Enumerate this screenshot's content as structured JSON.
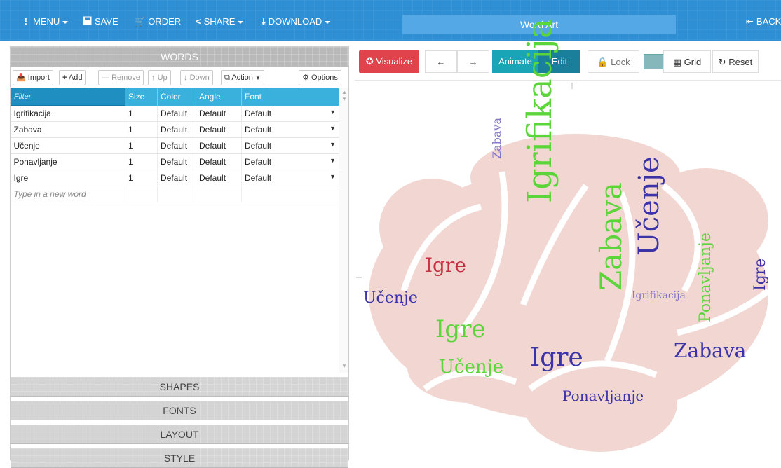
{
  "topbar": {
    "menu": "MENU",
    "save": "SAVE",
    "order": "ORDER",
    "share": "SHARE",
    "download": "DOWNLOAD",
    "title": "Word Art",
    "back": "BACK",
    "color": "#2f8fd4"
  },
  "left": {
    "words_header": "WORDS",
    "toolbar": {
      "import": "Import",
      "add": "Add",
      "remove": "Remove",
      "up": "Up",
      "down": "Down",
      "action": "Action",
      "options": "Options"
    },
    "columns": {
      "filter": "Filter",
      "size": "Size",
      "color": "Color",
      "angle": "Angle",
      "font": "Font"
    },
    "rows": [
      {
        "word": "Igrifikacija",
        "size": "1",
        "color": "Default",
        "angle": "Default",
        "font": "Default"
      },
      {
        "word": "Zabava",
        "size": "1",
        "color": "Default",
        "angle": "Default",
        "font": "Default"
      },
      {
        "word": "Učenje",
        "size": "1",
        "color": "Default",
        "angle": "Default",
        "font": "Default"
      },
      {
        "word": "Ponavljanje",
        "size": "1",
        "color": "Default",
        "angle": "Default",
        "font": "Default"
      },
      {
        "word": "Igre",
        "size": "1",
        "color": "Default",
        "angle": "Default",
        "font": "Default"
      }
    ],
    "new_word_placeholder": "Type in a new word",
    "sections": {
      "shapes": "SHAPES",
      "fonts": "FONTS",
      "layout": "LAYOUT",
      "style": "STYLE"
    }
  },
  "right": {
    "visualize": "Visualize",
    "animate": "Animate",
    "edit": "Edit",
    "lock": "Lock",
    "grid": "Grid",
    "reset": "Reset",
    "swatch_color": "#86b8bb"
  },
  "cloud": {
    "words": [
      "Igrifikacija",
      "Zabava",
      "Učenje",
      "Igre",
      "Igre",
      "Učenje",
      "Igre",
      "Zabava",
      "Ponavljanje",
      "Igre",
      "Učenje",
      "Ponavljanje",
      "Igrifikacija",
      "Zabava"
    ],
    "colors": [
      "#5bd53a",
      "#3a34a8",
      "#c3303f",
      "#7f73c9",
      "#38b6c8"
    ]
  }
}
